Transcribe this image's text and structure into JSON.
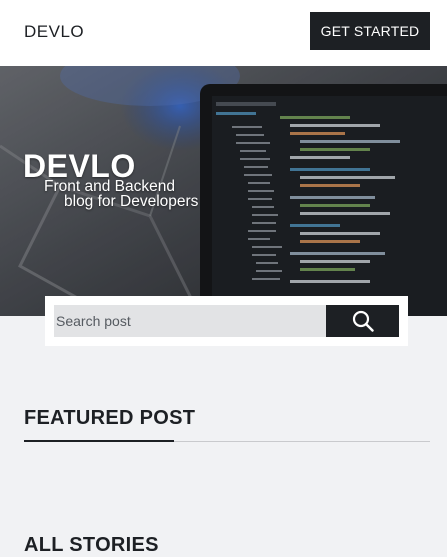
{
  "header": {
    "brand": "DEVLO",
    "cta_label": "GET STARTED"
  },
  "hero": {
    "title": "DEVLO",
    "subtitle_line1": "Front and Backend",
    "subtitle_line2": "blog for Developers"
  },
  "search": {
    "placeholder": "Search post",
    "button_icon": "search-icon"
  },
  "sections": {
    "featured_title": "FEATURED POST",
    "stories_title": "ALL STORIES"
  },
  "colors": {
    "dark": "#1d2024",
    "page_bg": "#f1f2f4",
    "input_bg": "#e2e3e5"
  }
}
